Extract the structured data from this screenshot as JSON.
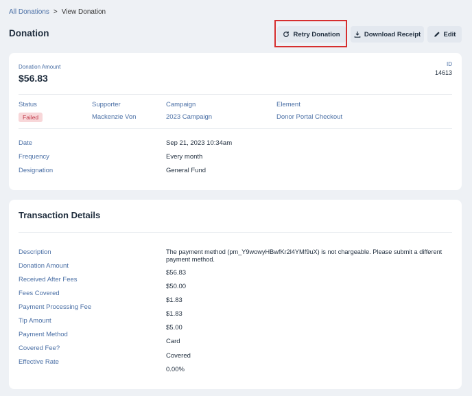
{
  "breadcrumb": {
    "parent": "All Donations",
    "separator": ">",
    "current": "View Donation"
  },
  "page_title": "Donation",
  "toolbar": {
    "retry_label": "Retry Donation",
    "download_label": "Download Receipt",
    "edit_label": "Edit"
  },
  "summary": {
    "amount_label": "Donation Amount",
    "amount_value": "$56.83",
    "id_label": "ID",
    "id_value": "14613",
    "status_label": "Status",
    "status_value": "Failed",
    "supporter_label": "Supporter",
    "supporter_value": "Mackenzie Von",
    "campaign_label": "Campaign",
    "campaign_value": "2023 Campaign",
    "element_label": "Element",
    "element_value": "Donor Portal Checkout",
    "date_label": "Date",
    "date_value": "Sep 21, 2023 10:34am",
    "frequency_label": "Frequency",
    "frequency_value": "Every month",
    "designation_label": "Designation",
    "designation_value": "General Fund"
  },
  "transaction": {
    "title": "Transaction Details",
    "description_label": "Description",
    "description_value": "The payment method (pm_Y9wowyHBwfKr2l4YMf9uX) is not chargeable. Please submit a different payment method.",
    "rows": [
      {
        "label": "Donation Amount",
        "value": "$56.83"
      },
      {
        "label": "Received After Fees",
        "value": "$50.00"
      },
      {
        "label": "Fees Covered",
        "value": "$1.83"
      },
      {
        "label": "Payment Processing Fee",
        "value": "$1.83"
      },
      {
        "label": "Tip Amount",
        "value": "$5.00"
      },
      {
        "label": "Payment Method",
        "value": "Card"
      },
      {
        "label": "Covered Fee?",
        "value": "Covered"
      },
      {
        "label": "Effective Rate",
        "value": "0.00%"
      }
    ]
  },
  "colors": {
    "accent": "#4a6fa5",
    "failed_bg": "#f8d7d9",
    "failed_text": "#c0394a",
    "highlight": "#d62e2e"
  }
}
